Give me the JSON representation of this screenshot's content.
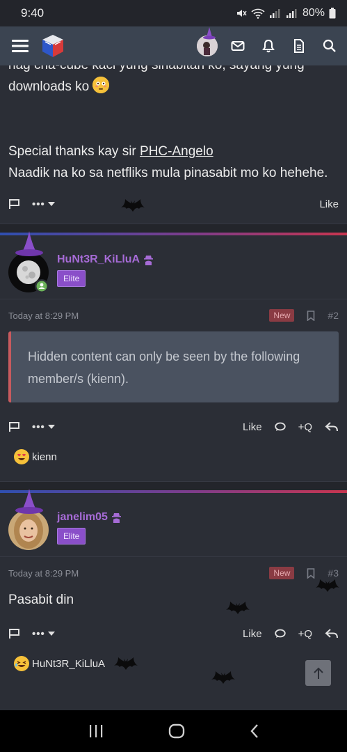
{
  "status_bar": {
    "time": "9:40",
    "battery": "80%"
  },
  "navbar": {
    "menu_icon": "hamburger-icon",
    "logo": "cube-logo",
    "icons": [
      "avatar",
      "mail-icon",
      "bell-icon",
      "document-icon",
      "search-icon"
    ]
  },
  "post1": {
    "partial_line": "nag cha-cube kaci yung sinabitan ko, sayang yung",
    "line2": "downloads ko",
    "thanks_prefix": "Special thanks kay sir ",
    "thanks_link": "PHC-Angelo",
    "line4": "Naadik na ko sa netfliks mula pinasabit mo ko hehehe.",
    "like_label": "Like"
  },
  "post2": {
    "username": "HuNt3R_KiLluA",
    "badge": "Elite",
    "timestamp": "Today at 8:29 PM",
    "new_label": "New",
    "post_number": "#2",
    "hidden_content": "Hidden content can only be seen by the following member/s (kienn).",
    "like_label": "Like",
    "quote_label": "+Q",
    "reaction_user": "kienn"
  },
  "post3": {
    "username": "janelim05",
    "badge": "Elite",
    "timestamp": "Today at 8:29 PM",
    "new_label": "New",
    "post_number": "#3",
    "body": "Pasabit din",
    "like_label": "Like",
    "quote_label": "+Q",
    "reaction_user": "HuNt3R_KiLluA"
  },
  "colors": {
    "background": "#2b2e36",
    "navbar": "#3b4451",
    "username": "#a66bd6",
    "badge": "#8a4fc9",
    "hidden_box": "#4a5260",
    "new_badge": "#8a3b43"
  }
}
